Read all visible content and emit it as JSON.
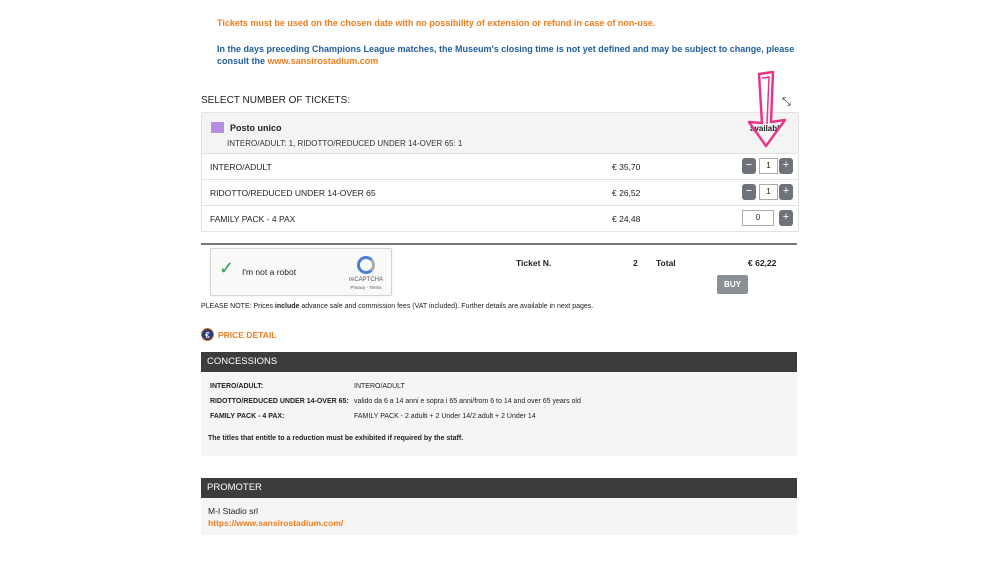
{
  "notices": {
    "tickets_rule": "Tickets must be used on the chosen date with no possibility of extension or refund in case of non-use.",
    "closing_time": "In the days preceding Champions League matches, the Museum's closing time is not yet defined and may be subject to change, please consult the ",
    "closing_link": "www.sansirostadium.com"
  },
  "select_label": "SELECT NUMBER OF TICKETS:",
  "posto": {
    "name": "Posto unico",
    "summary": "INTERO/ADULT: 1, RIDOTTO/REDUCED UNDER 14-OVER 65: 1",
    "availability": "availabl",
    "swatch_color": "#b78fe0"
  },
  "rows": [
    {
      "label": "INTERO/ADULT",
      "price": "€ 35,70",
      "qty": "1"
    },
    {
      "label": "RIDOTTO/REDUCED UNDER 14-OVER 65",
      "price": "€ 26,52",
      "qty": "1"
    },
    {
      "label": "FAMILY PACK - 4 PAX",
      "price": "€ 24,48",
      "qty": "0"
    }
  ],
  "stepper": {
    "minus": "−",
    "plus": "+"
  },
  "captcha": {
    "check": "✓",
    "label": "I'm not a robot",
    "brand": "reCAPTCHA",
    "links": "Privacy - Terms"
  },
  "summary": {
    "ticket_label": "Ticket N.",
    "ticket_count": "2",
    "total_label": "Total",
    "total_value": "€ 62,22",
    "buy_label": "BUY"
  },
  "please_note": {
    "prefix": "PLEASE NOTE: Prices ",
    "bold": "include",
    "suffix": " advance sale and commission fees (VAT included). Further details are available in next pages."
  },
  "price_detail": {
    "icon": "€",
    "label": "PRICE DETAIL"
  },
  "concessions": {
    "title": "CONCESSIONS",
    "items": [
      {
        "key": "INTERO/ADULT:",
        "value": "INTERO/ADULT"
      },
      {
        "key": "RIDOTTO/REDUCED UNDER 14-OVER 65:",
        "value": "valido da 6 a 14 anni e sopra i 65 anni/from 6 to 14 and over 65 years old"
      },
      {
        "key": "FAMILY PACK - 4 PAX:",
        "value": "FAMILY PACK - 2 adulti + 2 Under 14/2 adult + 2 Under 14"
      }
    ],
    "note": "The titles that entitle to a reduction must be exhibited if required by the staff."
  },
  "promoter": {
    "title": "PROMOTER",
    "name": "M-I Stadio srl",
    "link": "https://www.sansirostadium.com/"
  },
  "icons": {
    "collapse": "⤡"
  }
}
